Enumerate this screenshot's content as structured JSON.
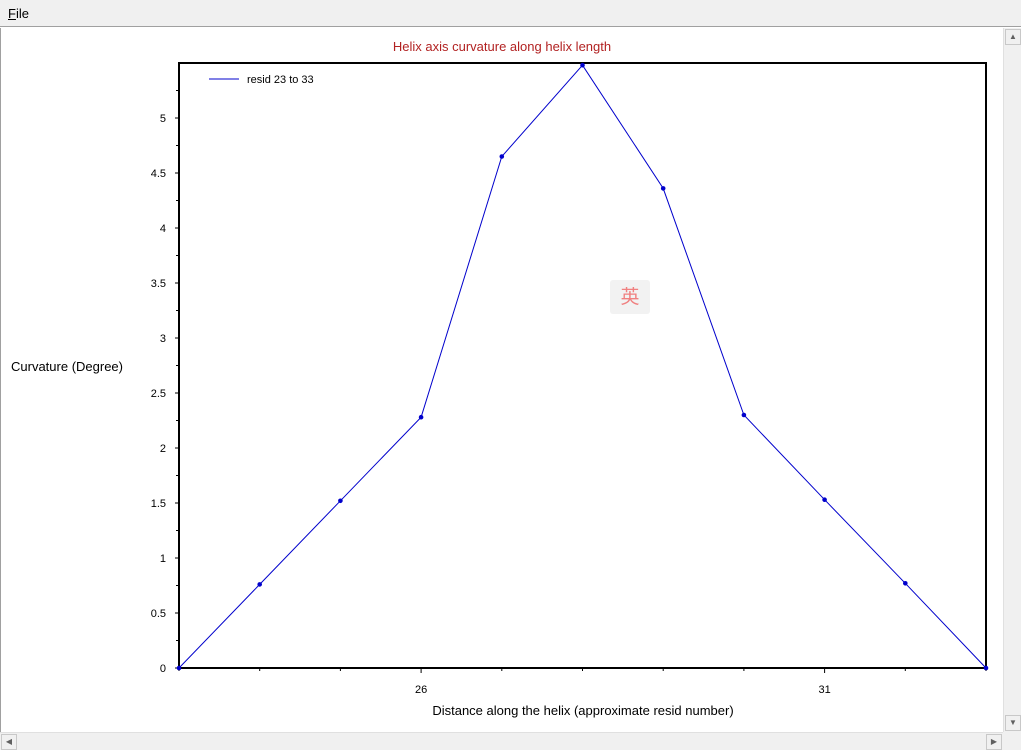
{
  "menubar": {
    "file_label": "File"
  },
  "chart_data": {
    "type": "line",
    "title": "Helix axis curvature along helix length",
    "xlabel": "Distance along the helix (approximate resid number)",
    "ylabel": "Curvature (Degree)",
    "xlim": [
      23,
      33
    ],
    "ylim": [
      0,
      5.5
    ],
    "x_ticks": [
      26,
      31
    ],
    "y_ticks": [
      0,
      0.5,
      1,
      1.5,
      2,
      2.5,
      3,
      3.5,
      4,
      4.5,
      5
    ],
    "legend_position": "top-left",
    "grid": false,
    "series": [
      {
        "name": "resid 23 to 33",
        "color": "#0000cc",
        "x": [
          23,
          24,
          25,
          26,
          27,
          28,
          29,
          30,
          31,
          32,
          33
        ],
        "y": [
          0,
          0.76,
          1.52,
          2.28,
          4.65,
          5.48,
          4.36,
          2.3,
          1.53,
          0.77,
          0
        ]
      }
    ]
  },
  "overlay": {
    "ime_indicator": "英"
  },
  "scrollbars": {
    "up_arrow": "▲",
    "down_arrow": "▼",
    "left_arrow": "◀",
    "right_arrow": "▶"
  }
}
